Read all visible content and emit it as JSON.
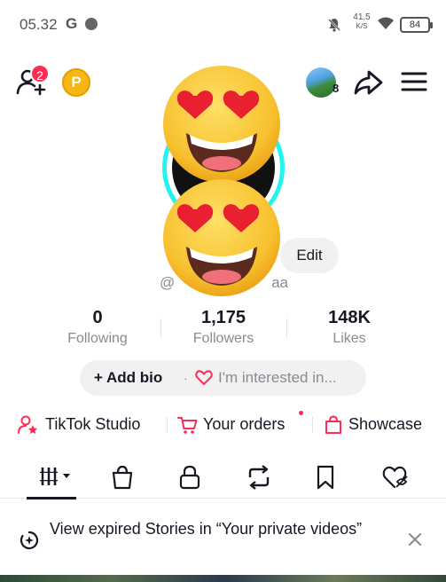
{
  "status_bar": {
    "time": "05.32",
    "g_label": "G",
    "net_speed_value": "41,5",
    "net_speed_unit": "K/S",
    "battery": "84"
  },
  "top_bar": {
    "notification_count": "2",
    "coin_label": "P",
    "accounts_count": "8"
  },
  "profile": {
    "edit_label": "Edit",
    "username_prefix": "@",
    "username_suffix": "aa"
  },
  "stats": [
    {
      "value": "0",
      "label": "Following"
    },
    {
      "value": "1,175",
      "label": "Followers"
    },
    {
      "value": "148K",
      "label": "Likes"
    }
  ],
  "bio": {
    "add_bio": "+ Add bio",
    "separator": "·",
    "interest": "I'm interested in..."
  },
  "shortcuts": {
    "studio": "TikTok Studio",
    "orders": "Your orders",
    "showcase": "Showcase"
  },
  "banner": {
    "text": "View expired Stories in “Your private videos”"
  },
  "colors": {
    "accent": "#fe2c55",
    "ring": "#25f4ee",
    "coin": "#f8b614"
  }
}
